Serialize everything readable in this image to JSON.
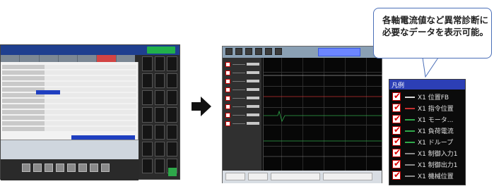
{
  "callout": {
    "text": "各軸電流値など異常診断に必要なデータを表示可能。"
  },
  "legend": {
    "header": "凡例",
    "items": [
      {
        "label": "X1 位置FB"
      },
      {
        "label": "X1 指令位置"
      },
      {
        "label": "X1 モータ..."
      },
      {
        "label": "X1 負荷電流"
      },
      {
        "label": "X1 ドループ"
      },
      {
        "label": "X1 制御入力1"
      },
      {
        "label": "X1 制御出力1"
      },
      {
        "label": "X1 機械位置"
      }
    ]
  },
  "colors": {
    "titlebar": "#1f3f8f",
    "legend_header": "#2c3fb5",
    "checkbox_mark": "#dd0000",
    "arrow": "#111111",
    "callout_border": "#4b6fb8"
  },
  "icons": {
    "arrow": "right-arrow-icon",
    "checkmark": "check-icon"
  }
}
